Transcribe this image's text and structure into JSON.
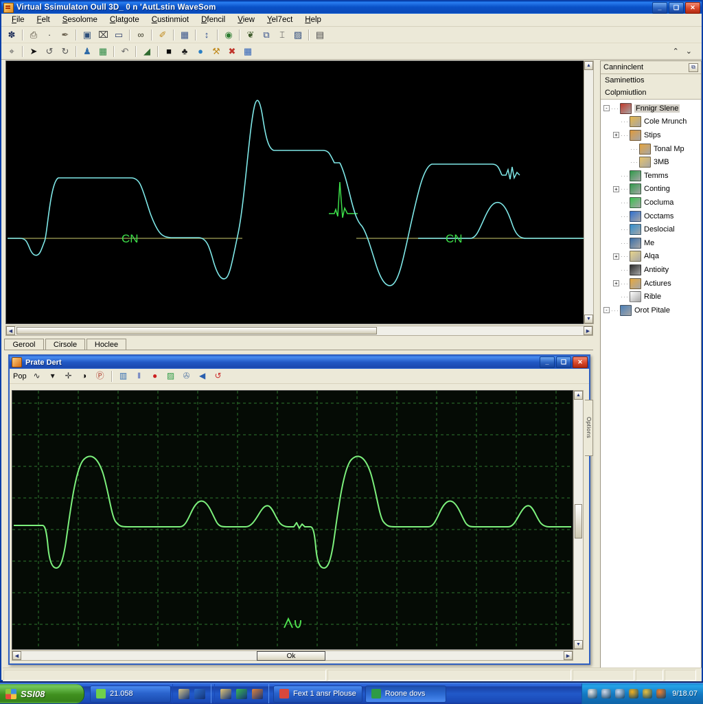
{
  "window": {
    "title": "Virtual Ssimulaton Oull 3D_ 0 n 'AutLstin WaveSom",
    "icon": "app-icon",
    "minimize": "_",
    "maximize": "❑",
    "close": "✕"
  },
  "menu": {
    "items": [
      {
        "label": "File"
      },
      {
        "label": "Felt"
      },
      {
        "label": "Sesolome"
      },
      {
        "label": "Clatgote"
      },
      {
        "label": "Custinmiot"
      },
      {
        "label": "Dfencil"
      },
      {
        "label": "View"
      },
      {
        "label": "Yel7ect"
      },
      {
        "label": "Help"
      }
    ]
  },
  "toolbar_row1": {
    "buttons": [
      {
        "name": "new-doc-button",
        "glyph": "✽",
        "color": "#1f2f5a"
      },
      {
        "sep": true
      },
      {
        "name": "print-button",
        "glyph": "⎙",
        "color": "#4a4132"
      },
      {
        "name": "dot-button",
        "glyph": "·",
        "color": "#333333"
      },
      {
        "name": "pen-button",
        "glyph": "✒",
        "color": "#6b6250"
      },
      {
        "sep": true
      },
      {
        "name": "image-frame-button",
        "glyph": "▣",
        "color": "#2d4f7a"
      },
      {
        "name": "crop-button",
        "glyph": "⌧",
        "color": "#3a3a3a"
      },
      {
        "name": "chart-view-button",
        "glyph": "▭",
        "color": "#2b3c6a"
      },
      {
        "sep": true
      },
      {
        "name": "glasses-button",
        "glyph": "∞",
        "color": "#3b3b2a"
      },
      {
        "sep": true
      },
      {
        "name": "brush-button",
        "glyph": "✐",
        "color": "#c08a1d"
      },
      {
        "sep": true
      },
      {
        "name": "grid-button",
        "glyph": "▦",
        "color": "#39558c"
      },
      {
        "sep": true
      },
      {
        "name": "measure-button",
        "glyph": "↕",
        "color": "#2f4f8f"
      },
      {
        "sep": true
      },
      {
        "name": "globe-button",
        "glyph": "◉",
        "color": "#2e7d32"
      },
      {
        "sep": true
      },
      {
        "name": "node-button",
        "glyph": "❦",
        "color": "#3d5a2a"
      },
      {
        "name": "copy-button",
        "glyph": "⧉",
        "color": "#35508c"
      },
      {
        "name": "ruler-button",
        "glyph": "⌶",
        "color": "#444444"
      },
      {
        "name": "window-button",
        "glyph": "▨",
        "color": "#2d4a7c"
      },
      {
        "sep": true
      },
      {
        "name": "calc-button",
        "glyph": "▤",
        "color": "#4b4b4b"
      }
    ]
  },
  "toolbar_row2": {
    "buttons": [
      {
        "name": "select-button",
        "glyph": "⌖",
        "color": "#5a5a5a"
      },
      {
        "sep": true
      },
      {
        "name": "arrow-button",
        "glyph": "➤",
        "color": "#111111"
      },
      {
        "name": "rotate-left-button",
        "glyph": "↺",
        "color": "#555555"
      },
      {
        "name": "rotate-right-button",
        "glyph": "↻",
        "color": "#555555"
      },
      {
        "sep": true
      },
      {
        "name": "person-button",
        "glyph": "♟",
        "color": "#2f6ba8"
      },
      {
        "name": "spreadsheet-button",
        "glyph": "▦",
        "color": "#2e8b45"
      },
      {
        "sep": true
      },
      {
        "name": "undo-button",
        "glyph": "↶",
        "color": "#6b6b6b"
      },
      {
        "sep": true
      },
      {
        "name": "flag-button",
        "glyph": "◢",
        "color": "#2f6b2f"
      },
      {
        "sep": true
      },
      {
        "name": "dark-panel-button",
        "glyph": "■",
        "color": "#0a0a0a"
      },
      {
        "name": "tree-button",
        "glyph": "♣",
        "color": "#1d1d1d"
      },
      {
        "name": "sphere-button",
        "glyph": "●",
        "color": "#2a7fc4"
      },
      {
        "name": "wrench-button",
        "glyph": "⚒",
        "color": "#c08a1d"
      },
      {
        "name": "delete-button",
        "glyph": "✖",
        "color": "#c0342a"
      },
      {
        "name": "blue-grid-button",
        "glyph": "▦",
        "color": "#2f62b8"
      }
    ],
    "chevron_up": "⌃",
    "chevron_down": "⌄"
  },
  "scope": {
    "label_left": "CN",
    "label_right": "CN",
    "trace_color": "#7fe8e8",
    "marker_color": "#3ddf4a",
    "baseline_color": "#8a8a4a",
    "background": "#000000"
  },
  "hscroll": {
    "left_arrow": "◀",
    "right_arrow": "▶"
  },
  "vscroll": {
    "up_arrow": "▲",
    "down_arrow": "▼"
  },
  "tabs": {
    "items": [
      {
        "label": "Gerool"
      },
      {
        "label": "Cirsole"
      },
      {
        "label": "Hoclee"
      }
    ]
  },
  "child_window": {
    "title": "Prate Dert",
    "minimize": "_",
    "maximize": "❑",
    "close": "✕",
    "toolbar": {
      "label": "Pop",
      "dropdown_caret": "▾",
      "buttons": [
        {
          "name": "wave-tool-button",
          "glyph": "∿",
          "color": "#2c2c2c"
        },
        {
          "name": "dropdown-button",
          "glyph": "▾",
          "color": "#1a1a1a"
        },
        {
          "name": "crosshair-button",
          "glyph": "✛",
          "color": "#3a3a3a"
        },
        {
          "name": "invert-button",
          "glyph": "◑",
          "color": "#0d0d0d"
        },
        {
          "name": "loop-button",
          "glyph": "Ⓟ",
          "color": "#b03a2a"
        },
        {
          "sep": true
        },
        {
          "name": "report-button",
          "glyph": "▥",
          "color": "#2f6bb0"
        },
        {
          "name": "bars-button",
          "glyph": "‖",
          "color": "#2f4fb8"
        },
        {
          "name": "record-button",
          "glyph": "●",
          "color": "#cc2020"
        },
        {
          "name": "calculator-button",
          "glyph": "▨",
          "color": "#2e9b45"
        },
        {
          "name": "share-button",
          "glyph": "✇",
          "color": "#5f7fa8"
        },
        {
          "name": "volume-button",
          "glyph": "◀",
          "color": "#2a5fae"
        },
        {
          "name": "refresh-button",
          "glyph": "↺",
          "color": "#cc2a2a"
        }
      ]
    },
    "plot": {
      "trace_color": "#7cf07c",
      "grid_color": "#2a6a2a",
      "background": "#050b05",
      "annotation": "Λω"
    },
    "ok_button": "Ok",
    "side_tab": "Options"
  },
  "right_panel": {
    "header": "Canninclent",
    "header_button": "⧉",
    "sub1": "Saminettios",
    "sub2": "Colpmiutlion",
    "tree": [
      {
        "label": "Fnnigr Slene",
        "depth": 0,
        "exp": "-",
        "icon": "scene-icon",
        "color": "#c0392b",
        "selected": true
      },
      {
        "label": "Cole Mrunch",
        "depth": 1,
        "exp": "",
        "icon": "branch-icon",
        "color": "#e8b84b",
        "selected": false
      },
      {
        "label": "Stips",
        "depth": 1,
        "exp": "+",
        "icon": "steps-icon",
        "color": "#e09a3a",
        "selected": false
      },
      {
        "label": "Tonal Mp",
        "depth": 2,
        "exp": "",
        "icon": "map-icon",
        "color": "#e5a33c",
        "selected": false
      },
      {
        "label": "3MB",
        "depth": 2,
        "exp": "",
        "icon": "folder-icon",
        "color": "#e8c46a",
        "selected": false
      },
      {
        "label": "Temms",
        "depth": 1,
        "exp": "",
        "icon": "pin-icon",
        "color": "#2f9b4a",
        "selected": false
      },
      {
        "label": "Conting",
        "depth": 1,
        "exp": "+",
        "icon": "arrow-down-icon",
        "color": "#2f9b4a",
        "selected": false
      },
      {
        "label": "Cocluma",
        "depth": 1,
        "exp": "",
        "icon": "node-icon",
        "color": "#3ac04f",
        "selected": false
      },
      {
        "label": "Occtams",
        "depth": 1,
        "exp": "",
        "icon": "triangle-icon",
        "color": "#2f6fd0",
        "selected": false
      },
      {
        "label": "Deslocial",
        "depth": 1,
        "exp": "",
        "icon": "anchor-icon",
        "color": "#2f8fd0",
        "selected": false
      },
      {
        "label": "Me",
        "depth": 1,
        "exp": "",
        "icon": "monitor-icon",
        "color": "#3a6fa8",
        "selected": false
      },
      {
        "label": "Alqa",
        "depth": 1,
        "exp": "+",
        "icon": "cone-icon",
        "color": "#e8d48a",
        "selected": false
      },
      {
        "label": "Antioity",
        "depth": 1,
        "exp": "",
        "icon": "box-icon",
        "color": "#2b2b2b",
        "selected": false
      },
      {
        "label": "Actiures",
        "depth": 1,
        "exp": "+",
        "icon": "edit-icon",
        "color": "#e8a83c",
        "selected": false
      },
      {
        "label": "Rible",
        "depth": 1,
        "exp": "",
        "icon": "function-icon",
        "color": "#ffffff",
        "selected": false
      },
      {
        "label": "Orot Pitale",
        "depth": 0,
        "exp": "-",
        "icon": "image-icon",
        "color": "#4a7fb8",
        "selected": false
      }
    ]
  },
  "taskbar": {
    "start_label": "SSI08",
    "quick_launch": [
      {
        "name": "explorer-icon",
        "color": "#d8c78a"
      },
      {
        "name": "ie-icon",
        "color": "#2f6fd0"
      }
    ],
    "quick_launch2": [
      {
        "name": "folder-icon",
        "color": "#e3c878"
      },
      {
        "name": "chrome-icon",
        "color": "#3cba54"
      },
      {
        "name": "paint-icon",
        "color": "#e0843c"
      }
    ],
    "buttons": [
      {
        "label": "21.058",
        "icon_color": "#6fcf4a",
        "active": false
      },
      {
        "label": "Fext 1 ansr Plouse",
        "icon_color": "#d8483c",
        "active": false
      },
      {
        "label": "Roone dovs",
        "icon_color": "#2e9b45",
        "active": true
      }
    ],
    "tray_icons": [
      {
        "name": "volume-icon",
        "color": "#e8e8e8"
      },
      {
        "name": "network-icon",
        "color": "#cfd8e8"
      },
      {
        "name": "shield-icon",
        "color": "#c8d8f0"
      },
      {
        "name": "update-icon",
        "color": "#f0b020"
      },
      {
        "name": "antivirus-icon",
        "color": "#e8c040"
      },
      {
        "name": "battery-icon",
        "color": "#f08030"
      }
    ],
    "clock": "9/18.07"
  },
  "chart_data": {
    "type": "line",
    "title": "Waveform traces",
    "charts": [
      {
        "name": "main-scope-trace",
        "color": "#7fe8e8",
        "baseline_y": 0,
        "points": "plateau-ramp-dip-spike composite, two cycles with CN baseline markers"
      },
      {
        "name": "detail-ecg-trace",
        "color": "#7cf07c",
        "baseline_y": 0,
        "points": "ECG-like: Q-dip, tall R peak, T bumps, repeated twice"
      }
    ]
  }
}
